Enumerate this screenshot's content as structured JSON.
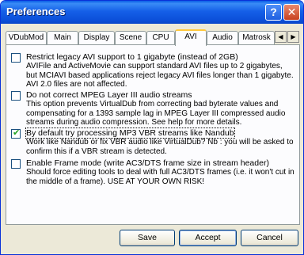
{
  "window": {
    "title": "Preferences"
  },
  "titlebar": {
    "help_glyph": "?",
    "close_glyph": "✕"
  },
  "tabs": [
    {
      "label": "VDubMod"
    },
    {
      "label": "Main"
    },
    {
      "label": "Display"
    },
    {
      "label": "Scene"
    },
    {
      "label": "CPU"
    },
    {
      "label": "AVI"
    },
    {
      "label": "Audio"
    },
    {
      "label": "Matrosk"
    }
  ],
  "tab_scroll": {
    "left": "◀",
    "right": "▶"
  },
  "options": [
    {
      "checked": false,
      "label": "Restrict legacy AVI support to 1 gigabyte (instead of 2GB)",
      "description": "AVIFile and ActiveMovie can support standard AVI files up to 2 gigabytes, but MCIAVI based applications reject legacy AVI files longer than 1 gigabyte. AVI 2.0 files are not affected."
    },
    {
      "checked": false,
      "label": "Do not correct MPEG Layer III audio streams",
      "description": "This option prevents VirtualDub from correcting bad byterate values and compensating for a 1393 sample lag in MPEG Layer III compressed audio streams during audio compression. See help for more details."
    },
    {
      "checked": true,
      "label": "By default try processing MP3 VBR streams like Nandub",
      "description": "Work like Nandub or fix VBR audio like VirtualDub? Nb : you will be asked to confirm this if a VBR stream is detected."
    },
    {
      "checked": false,
      "label": "Enable Frame mode (write AC3/DTS frame size in stream header)",
      "description": "Should force editing tools to deal with full AC3/DTS frames (i.e. it won't cut in the middle of a frame). USE AT YOUR OWN RISK!"
    }
  ],
  "check_glyph": "✔",
  "buttons": {
    "save": "Save",
    "accept": "Accept",
    "cancel": "Cancel"
  }
}
